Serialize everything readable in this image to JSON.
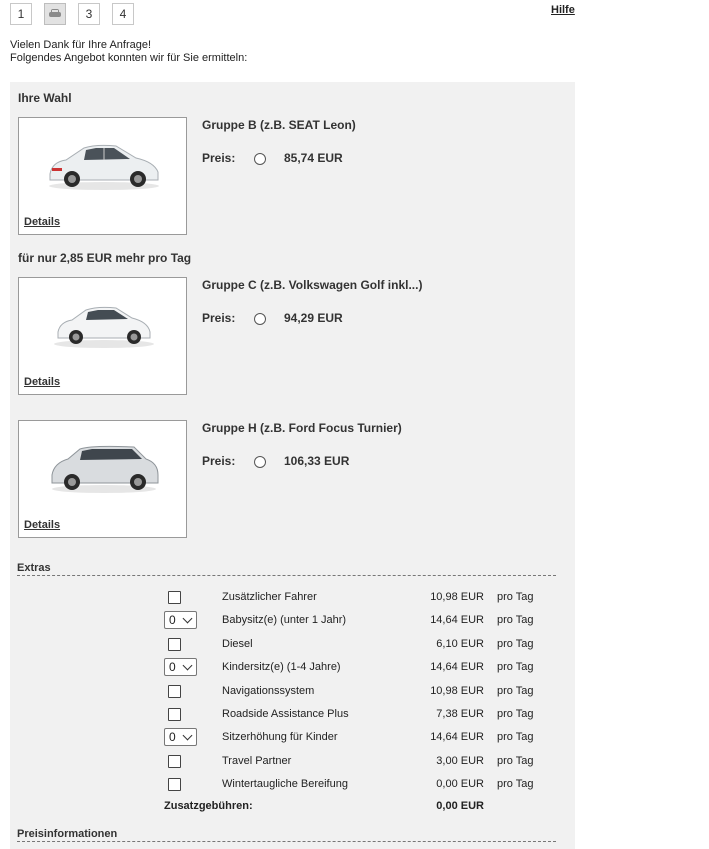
{
  "steps": [
    {
      "label": "1"
    },
    {
      "label": "",
      "icon": "car-icon",
      "active": true
    },
    {
      "label": "3"
    },
    {
      "label": "4"
    }
  ],
  "help_label": "Hilfe",
  "intro": {
    "line1": "Vielen Dank für Ihre Anfrage!",
    "line2": "Folgendes Angebot konnten wir für Sie ermitteln:"
  },
  "choice_heading": "Ihre Wahl",
  "upsell_heading": "für nur 2,85 EUR mehr pro Tag",
  "price_label": "Preis:",
  "details_label": "Details",
  "cars": [
    {
      "title": "Gruppe B (z.B. SEAT Leon)",
      "price": "85,74 EUR",
      "image": "hatchback-white"
    },
    {
      "title": "Gruppe C (z.B. Volkswagen Golf inkl...)",
      "price": "94,29 EUR",
      "image": "hatchback-white"
    },
    {
      "title": "Gruppe H (z.B. Ford Focus Turnier)",
      "price": "106,33 EUR",
      "image": "estate-silver"
    }
  ],
  "extras_heading": "Extras",
  "extras": [
    {
      "control": "checkbox",
      "name": "Zusätzlicher Fahrer",
      "price": "10,98 EUR",
      "unit": "pro Tag"
    },
    {
      "control": "select",
      "value": "0",
      "name": "Babysitz(e) (unter 1 Jahr)",
      "price": "14,64 EUR",
      "unit": "pro Tag"
    },
    {
      "control": "checkbox",
      "name": "Diesel",
      "price": "6,10 EUR",
      "unit": "pro Tag"
    },
    {
      "control": "select",
      "value": "0",
      "name": "Kindersitz(e) (1-4 Jahre)",
      "price": "14,64 EUR",
      "unit": "pro Tag"
    },
    {
      "control": "checkbox",
      "name": "Navigationssystem",
      "price": "10,98 EUR",
      "unit": "pro Tag"
    },
    {
      "control": "checkbox",
      "name": "Roadside Assistance Plus",
      "price": "7,38 EUR",
      "unit": "pro Tag"
    },
    {
      "control": "select",
      "value": "0",
      "name": "Sitzerhöhung für Kinder",
      "price": "14,64 EUR",
      "unit": "pro Tag"
    },
    {
      "control": "checkbox",
      "name": "Travel Partner",
      "price": "3,00 EUR",
      "unit": "pro Tag"
    },
    {
      "control": "checkbox",
      "name": "Wintertaugliche Bereifung",
      "price": "0,00 EUR",
      "unit": "pro Tag"
    }
  ],
  "fees": {
    "label": "Zusatzgebühren:",
    "value": "0,00 EUR"
  },
  "price_info_heading": "Preisinformationen"
}
